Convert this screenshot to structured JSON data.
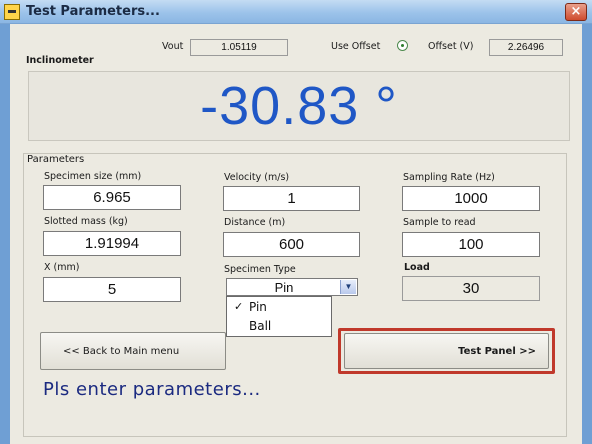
{
  "window": {
    "title": "Test Parameters...",
    "close_label": "×"
  },
  "inclinometer": {
    "section_label": "Inclinometer",
    "vout_label": "Vout",
    "vout_value": "1.05119",
    "use_offset_label": "Use Offset",
    "offset_label": "Offset (V)",
    "offset_value": "2.26496",
    "reading": "-30.83 °"
  },
  "parameters": {
    "section_label": "Parameters",
    "specimen_size_label": "Specimen size (mm)",
    "specimen_size_value": "6.965",
    "velocity_label": "Velocity (m/s)",
    "velocity_value": "1",
    "sampling_rate_label": "Sampling Rate (Hz)",
    "sampling_rate_value": "1000",
    "slotted_mass_label": "Slotted mass (kg)",
    "slotted_mass_value": "1.91994",
    "distance_label": "Distance (m)",
    "distance_value": "600",
    "sample_to_read_label": "Sample to read",
    "sample_to_read_value": "100",
    "x_label": "X (mm)",
    "x_value": "5",
    "specimen_type_label": "Specimen Type",
    "specimen_type_value": "Pin",
    "specimen_type_options": [
      "Pin",
      "Ball"
    ],
    "checkmark": "✓",
    "load_label": "Load",
    "load_value": "30"
  },
  "buttons": {
    "back_label": "<< Back to Main menu",
    "test_panel_label": "Test Panel >>"
  },
  "status": {
    "message": "Pls enter parameters..."
  },
  "colors": {
    "reading": "#1f57c6",
    "status": "#1b2a80",
    "highlight": "#c0392b"
  }
}
